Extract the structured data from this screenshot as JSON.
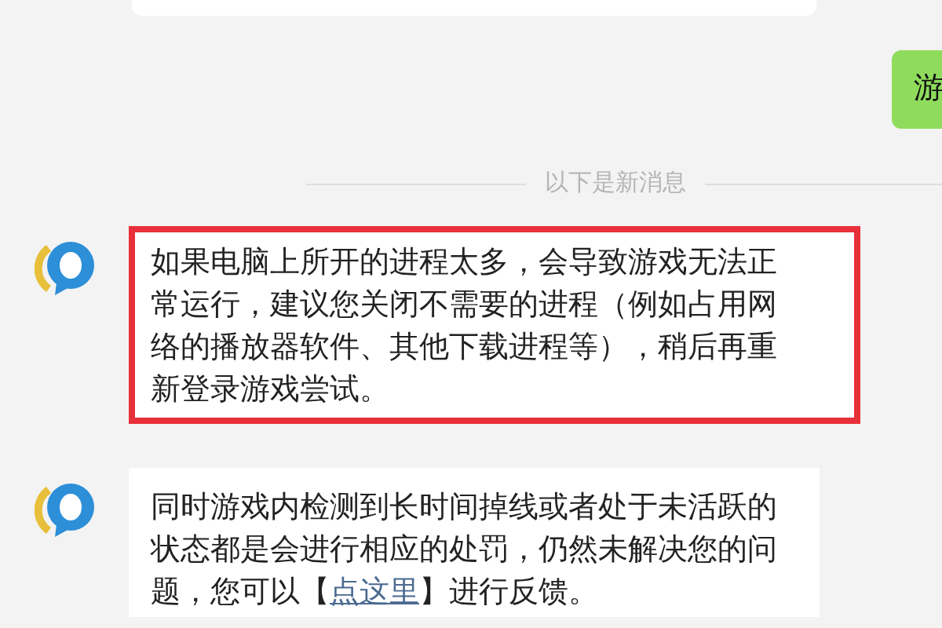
{
  "sent_message": {
    "text": "游"
  },
  "divider": {
    "text": "以下是新消息"
  },
  "messages": [
    {
      "kind": "plain",
      "highlighted": true,
      "text": "如果电脑上所开的进程太多，会导致游戏无法正常运行，建议您关闭不需要的进程（例如占用网络的播放器软件、其他下载进程等），稍后再重新登录游戏尝试。"
    },
    {
      "kind": "link",
      "highlighted": false,
      "text": "同时游戏内检测到长时间掉线或者处于未活跃的状态都是会进行相应的处罚，仍然未解决您的问题，您可以【",
      "link": "点这里",
      "text_after": "】进行反馈。"
    }
  ]
}
